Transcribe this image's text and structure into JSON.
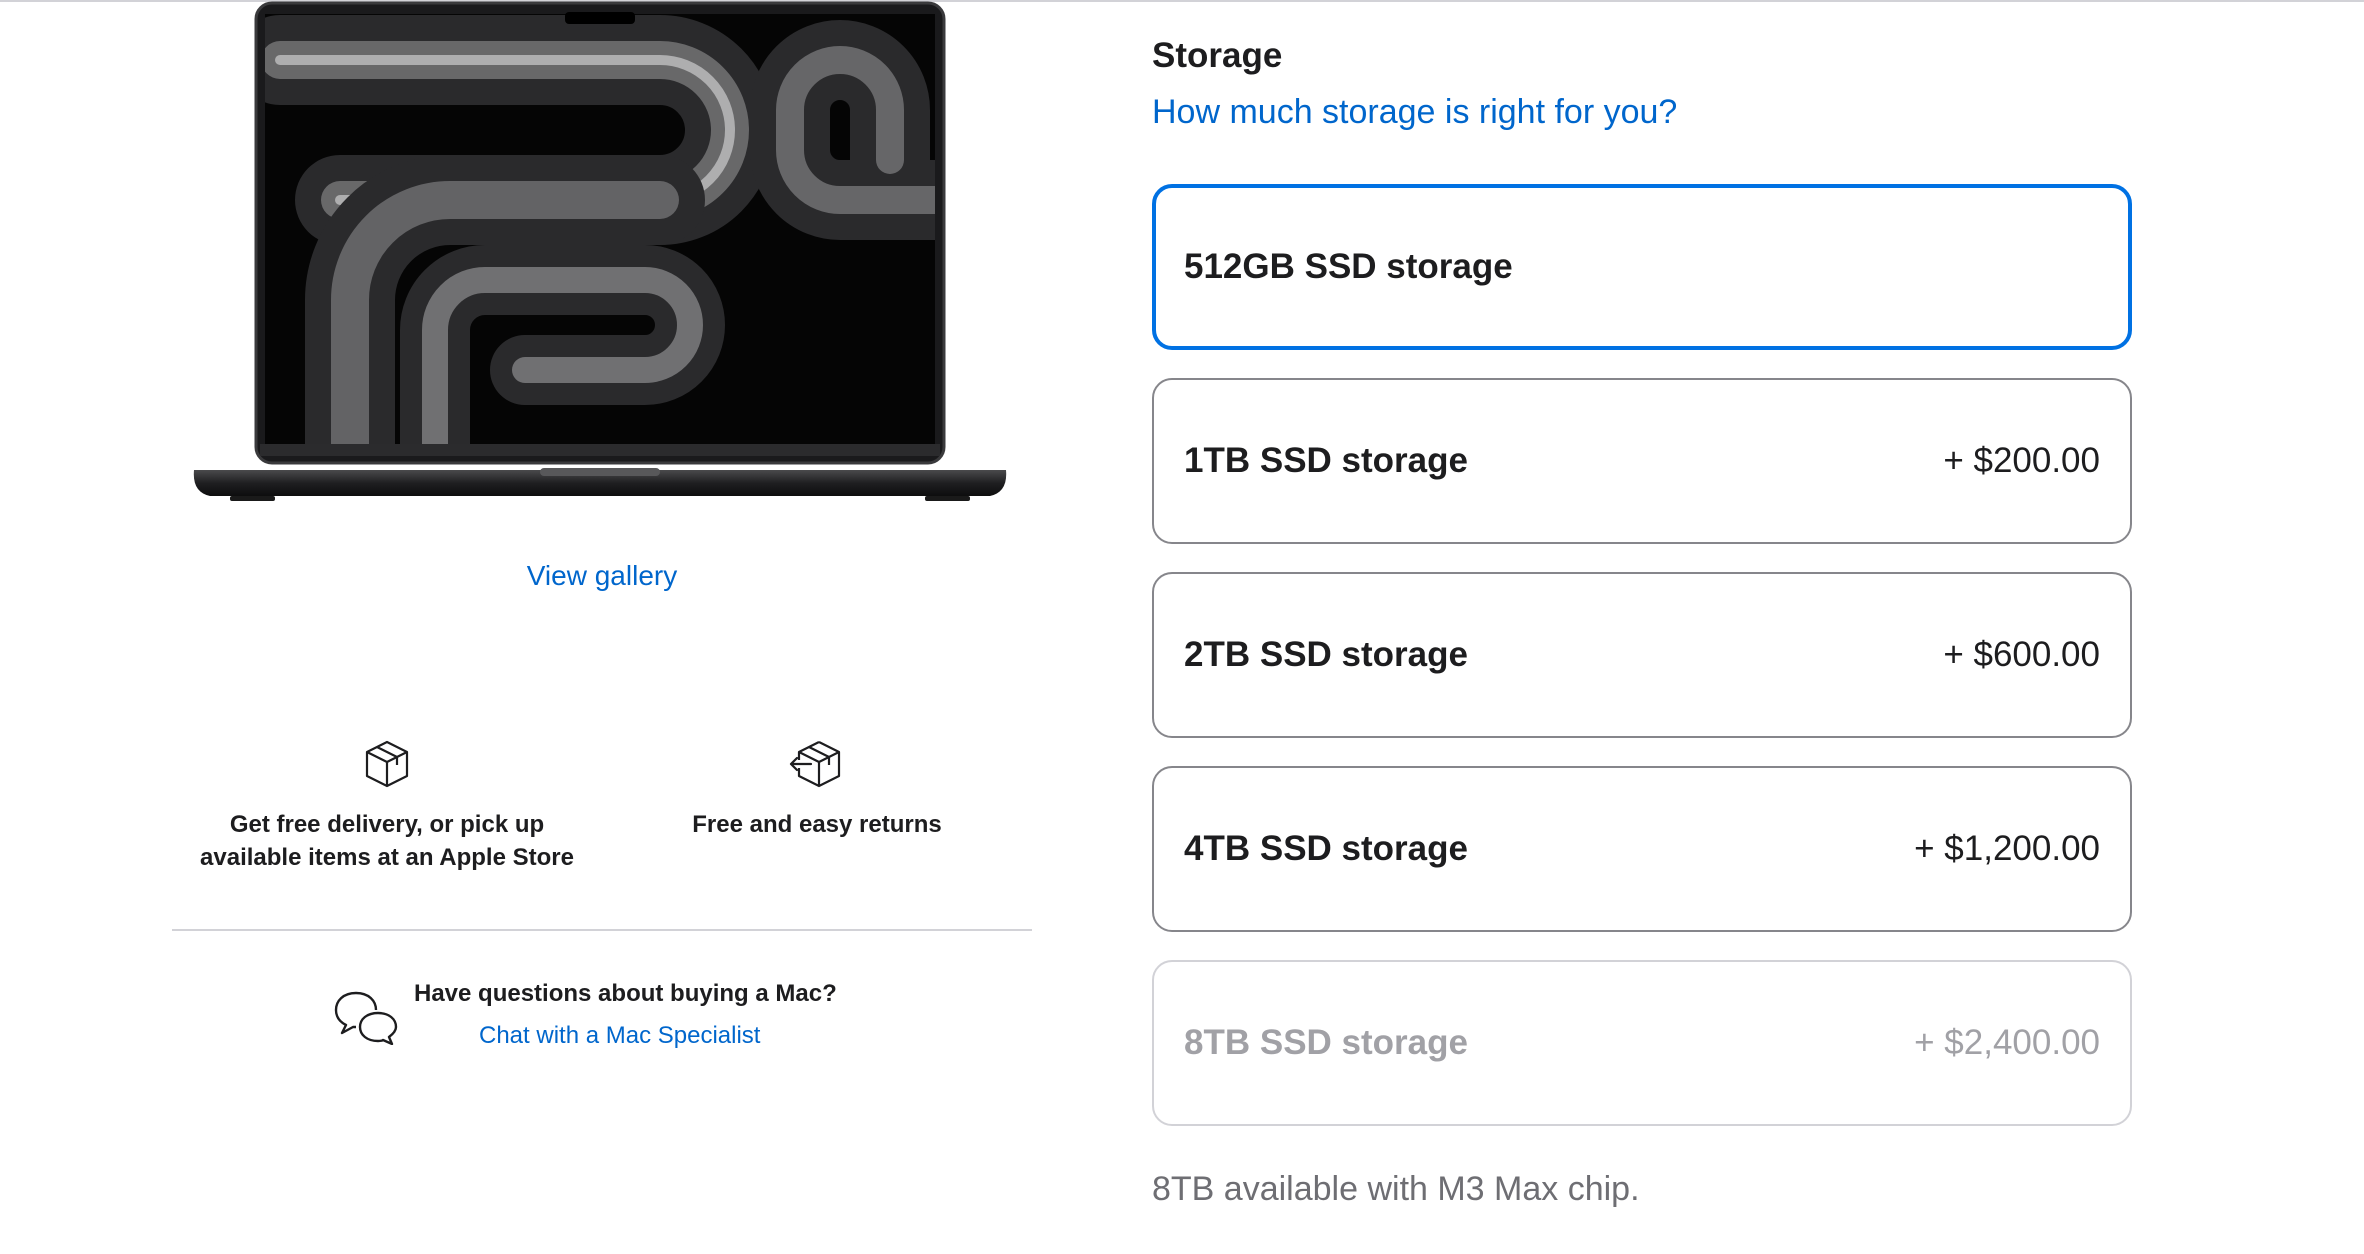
{
  "gallery": {
    "link_label": "View gallery"
  },
  "benefits": [
    {
      "icon": "package-icon",
      "line1": "Get free delivery, or pick up",
      "line2": "available items at an Apple Store"
    },
    {
      "icon": "return-package-icon",
      "line1": "Free and easy returns"
    }
  ],
  "help": {
    "icon": "chat-bubbles-icon",
    "question": "Have questions about buying a Mac?",
    "link_label": "Chat with a Mac Specialist"
  },
  "storage": {
    "title": "Storage",
    "help_link": "How much storage is right for you?",
    "options": [
      {
        "label": "512GB SSD storage",
        "price": "",
        "selected": true,
        "disabled": false
      },
      {
        "label": "1TB SSD storage",
        "price": "+ $200.00",
        "selected": false,
        "disabled": false
      },
      {
        "label": "2TB SSD storage",
        "price": "+ $600.00",
        "selected": false,
        "disabled": false
      },
      {
        "label": "4TB SSD storage",
        "price": "+ $1,200.00",
        "selected": false,
        "disabled": false
      },
      {
        "label": "8TB SSD storage",
        "price": "+ $2,400.00",
        "selected": false,
        "disabled": true
      }
    ],
    "footnote": "8TB available with M3 Max chip."
  },
  "colors": {
    "accent": "#0071e3",
    "link": "#0066cc",
    "text": "#1d1d1f",
    "disabled_text": "#a1a1a6",
    "border": "#86868b"
  }
}
